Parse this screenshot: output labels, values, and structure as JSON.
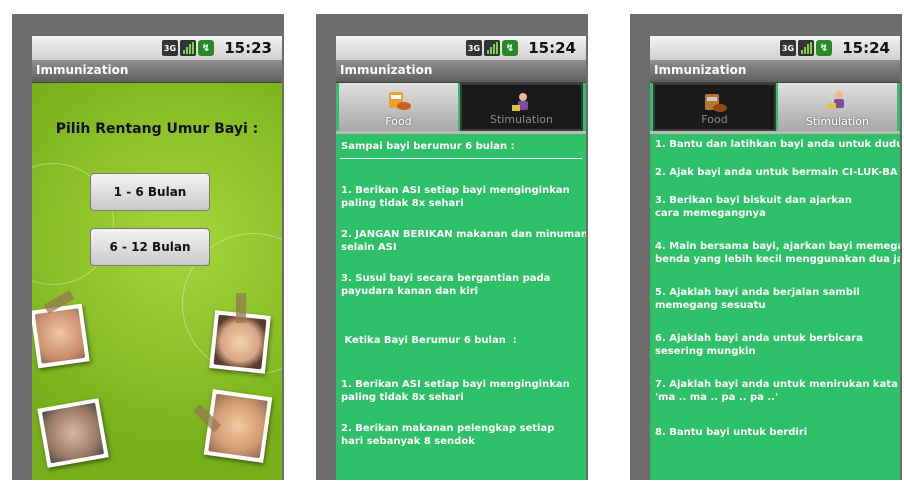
{
  "status_bar": {
    "icon_3g": "3G",
    "time": "15:23"
  },
  "app_title": "Immunization",
  "screen1": {
    "heading": "Pilih Rentang Umur Bayi :",
    "buttons": [
      "1 - 6 Bulan",
      "6 - 12 Bulan"
    ]
  },
  "screen2": {
    "time": "15:24",
    "tabs": [
      "Food",
      "Stimulation"
    ],
    "section1": "Sampai bayi berumur 6 bulan :",
    "items1": [
      "1. Berikan ASI setiap bayi menginginkan\npaling tidak 8x sehari",
      "2. JANGAN BERIKAN makanan dan minuman\nselain ASI",
      "3. Susui bayi secara bergantian pada\npayudara kanan dan kiri"
    ],
    "section2": " Ketika Bayi Berumur 6 bulan  :",
    "items2": [
      "1. Berikan ASI setiap bayi menginginkan\npaling tidak 8x sehari",
      "2. Berikan makanan pelengkap setiap\nhari sebanyak 8 sendok"
    ]
  },
  "screen3": {
    "time": "15:24",
    "tabs": [
      "Food",
      "Stimulation"
    ],
    "items": [
      "1. Bantu dan latihkan bayi anda untuk dudu",
      "2. Ajak bayi anda untuk bermain CI-LUK-BA",
      "3. Berikan bayi biskuit dan ajarkan\ncara memegangnya",
      "4. Main bersama bayi, ajarkan bayi memegan\nbenda yang lebih kecil menggunakan dua jar",
      "5. Ajaklah bayi anda berjalan sambil\nmemegang sesuatu",
      "6. Ajaklah bayi anda untuk berbicara\nsesering mungkin",
      "7. Ajaklah bayi anda untuk menirukan kata\n'ma .. ma .. pa .. pa ..'",
      "8. Bantu bayi untuk berdiri"
    ]
  },
  "colors": {
    "list_green": "#2ec16a",
    "accent_lime": "#8fc832"
  },
  "icons": [
    "3g-icon",
    "signal-icon",
    "battery-icon",
    "food-icon",
    "stimulation-icon"
  ]
}
